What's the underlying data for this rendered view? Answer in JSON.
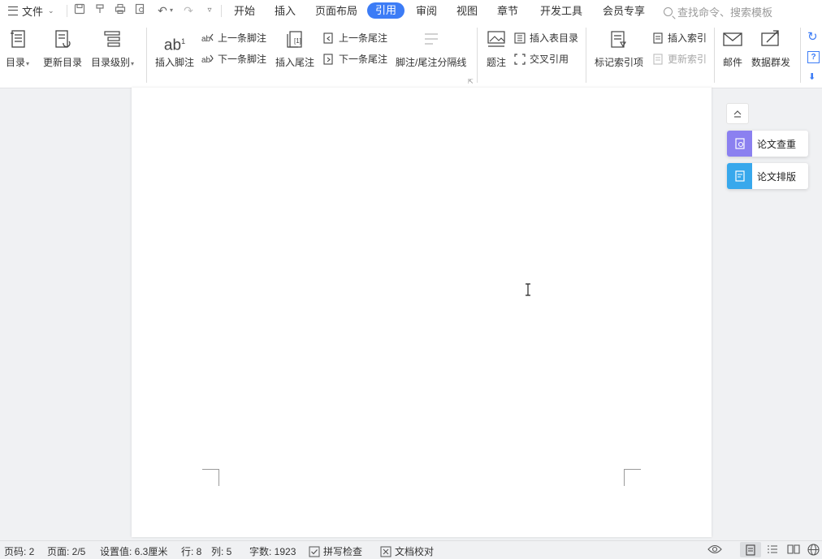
{
  "topbar": {
    "file_menu_label": "文件",
    "tabs": [
      {
        "label": "开始",
        "active": false
      },
      {
        "label": "插入",
        "active": false
      },
      {
        "label": "页面布局",
        "active": false
      },
      {
        "label": "引用",
        "active": true
      },
      {
        "label": "审阅",
        "active": false
      },
      {
        "label": "视图",
        "active": false
      },
      {
        "label": "章节",
        "active": false
      },
      {
        "label": "开发工具",
        "active": false
      },
      {
        "label": "会员专享",
        "active": false
      }
    ],
    "search_placeholder": "查找命令、搜索模板",
    "accent_color": "#3c7cf6"
  },
  "ribbon": {
    "toc": "目录",
    "update_toc": "更新目录",
    "toc_level": "目录级别",
    "insert_footnote": "插入脚注",
    "prev_footnote": "上一条脚注",
    "next_footnote": "下一条脚注",
    "insert_endnote": "插入尾注",
    "prev_endnote": "上一条尾注",
    "next_endnote": "下一条尾注",
    "separator_line": "脚注/尾注分隔线",
    "caption": "题注",
    "insert_table_of_figures": "插入表目录",
    "cross_reference": "交叉引用",
    "mark_index_entry": "标记索引项",
    "insert_index": "插入索引",
    "update_index": "更新索引",
    "mail": "邮件",
    "data_mass_send": "数据群发",
    "footnote_glyph": "ab"
  },
  "side_panel": {
    "plagiarism_check": "论文查重",
    "paper_formatting": "论文排版"
  },
  "status": {
    "page_code": "页码: 2",
    "pages": "页面: 2/5",
    "setting_value": "设置值: 6.3厘米",
    "row": "行: 8",
    "col": "列: 5",
    "word_count": "字数: 1923",
    "spell_check": "拼写检查",
    "doc_proofread": "文档校对"
  }
}
